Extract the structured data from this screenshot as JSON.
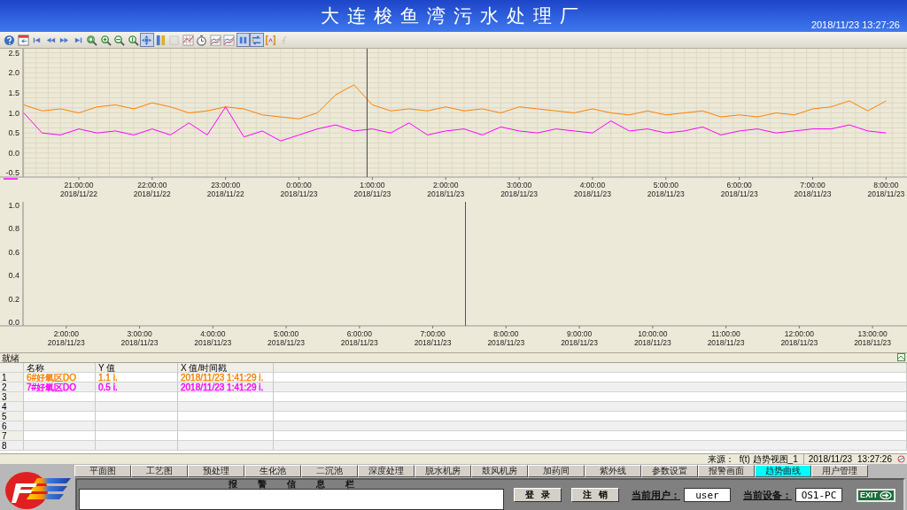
{
  "window": {
    "title": "大连梭鱼湾污水处理厂",
    "datetime": "2018/11/23 13:27:26"
  },
  "toolbar": [
    {
      "kind": "help",
      "pressed": false,
      "disabled": false
    },
    {
      "kind": "calendar",
      "pressed": false,
      "disabled": false
    },
    {
      "kind": "skip-start",
      "pressed": false,
      "disabled": false
    },
    {
      "kind": "rewind",
      "pressed": false,
      "disabled": false
    },
    {
      "kind": "fast-forward",
      "pressed": false,
      "disabled": false
    },
    {
      "kind": "skip-end",
      "pressed": false,
      "disabled": false
    },
    {
      "kind": "zoom-fit",
      "pressed": false,
      "disabled": false
    },
    {
      "kind": "zoom-in",
      "pressed": false,
      "disabled": false
    },
    {
      "kind": "zoom-horizontal",
      "pressed": false,
      "disabled": false
    },
    {
      "kind": "zoom-vertical",
      "pressed": false,
      "disabled": false
    },
    {
      "kind": "pan",
      "pressed": true,
      "disabled": false
    },
    {
      "kind": "ruler",
      "pressed": false,
      "disabled": false
    },
    {
      "kind": "blank",
      "pressed": false,
      "disabled": true
    },
    {
      "kind": "grid",
      "pressed": false,
      "disabled": false
    },
    {
      "kind": "timer",
      "pressed": false,
      "disabled": false
    },
    {
      "kind": "chart",
      "pressed": false,
      "disabled": false
    },
    {
      "kind": "chart",
      "pressed": false,
      "disabled": false
    },
    {
      "kind": "pause",
      "pressed": true,
      "disabled": false
    },
    {
      "kind": "swap",
      "pressed": true,
      "disabled": false
    },
    {
      "kind": "bracket",
      "pressed": false,
      "disabled": false
    },
    {
      "kind": "function",
      "pressed": false,
      "disabled": true
    }
  ],
  "trend_top": {
    "chart_data": {
      "type": "line",
      "grid": true,
      "ylim": [
        -0.6,
        2.6
      ],
      "yticks": [
        {
          "value": -0.5,
          "label": "-0.5"
        },
        {
          "value": 0,
          "label": "0.0"
        },
        {
          "value": 0.5,
          "label": "0.5"
        },
        {
          "value": 1,
          "label": "1.0"
        },
        {
          "value": 1.5,
          "label": "1.5"
        },
        {
          "value": 2,
          "label": "2.0"
        },
        {
          "value": 2.5,
          "label": "2.5"
        }
      ],
      "categories": [
        null,
        null,
        null,
        "21:00:00\n2018/11/22",
        null,
        null,
        null,
        "22:00:00\n2018/11/22",
        null,
        null,
        null,
        "23:00:00\n2018/11/22",
        null,
        null,
        null,
        "0:00:00\n2018/11/23",
        null,
        null,
        null,
        "1:00:00\n2018/11/23",
        null,
        null,
        null,
        "2:00:00\n2018/11/23",
        null,
        null,
        null,
        "3:00:00\n2018/11/23",
        null,
        null,
        null,
        "4:00:00\n2018/11/23",
        null,
        null,
        null,
        "5:00:00\n2018/11/23",
        null,
        null,
        null,
        "6:00:00\n2018/11/23",
        null,
        null,
        null,
        "7:00:00\n2018/11/23",
        null,
        null,
        null,
        "8:00:00\n2018/11/23"
      ],
      "series": [
        {
          "color": "#ff8000",
          "values": [
            1.2,
            1.05,
            1.1,
            1.0,
            1.15,
            1.2,
            1.1,
            1.25,
            1.15,
            1.0,
            1.05,
            1.15,
            1.1,
            0.95,
            0.9,
            0.85,
            1.0,
            1.45,
            1.7,
            1.2,
            1.05,
            1.1,
            1.05,
            1.15,
            1.05,
            1.1,
            1.0,
            1.15,
            1.1,
            1.05,
            1.0,
            1.1,
            1.0,
            0.95,
            1.05,
            0.95,
            1.0,
            1.05,
            0.9,
            0.95,
            0.9,
            1.0,
            0.95,
            1.1,
            1.15,
            1.3,
            1.05,
            1.3
          ]
        },
        {
          "color": "#ff00ff",
          "values": [
            1.0,
            0.5,
            0.45,
            0.6,
            0.5,
            0.55,
            0.45,
            0.6,
            0.45,
            0.75,
            0.45,
            1.15,
            0.4,
            0.55,
            0.3,
            0.45,
            0.6,
            0.7,
            0.55,
            0.6,
            0.5,
            0.75,
            0.45,
            0.55,
            0.6,
            0.45,
            0.65,
            0.55,
            0.5,
            0.6,
            0.55,
            0.5,
            0.8,
            0.55,
            0.6,
            0.5,
            0.55,
            0.65,
            0.45,
            0.55,
            0.6,
            0.5,
            0.55,
            0.6,
            0.6,
            0.7,
            0.55,
            0.5
          ]
        }
      ]
    }
  },
  "trend_bottom": {
    "chart_data": {
      "type": "line",
      "grid": false,
      "ylim": [
        -0.03,
        1.03
      ],
      "yticks": [
        {
          "value": 0,
          "label": "0.0"
        },
        {
          "value": 0.2,
          "label": "0.2"
        },
        {
          "value": 0.4,
          "label": "0.4"
        },
        {
          "value": 0.6,
          "label": "0.6"
        },
        {
          "value": 0.8,
          "label": "0.8"
        },
        {
          "value": 1,
          "label": "1.0"
        }
      ],
      "categories": [
        "2:00:00\n2018/11/23",
        "3:00:00\n2018/11/23",
        "4:00:00\n2018/11/23",
        "5:00:00\n2018/11/23",
        "6:00:00\n2018/11/23",
        "7:00:00\n2018/11/23",
        "8:00:00\n2018/11/23",
        "9:00:00\n2018/11/23",
        "10:00:00\n2018/11/23",
        "11:00:00\n2018/11/23",
        "12:00:00\n2018/11/23",
        "13:00:00\n2018/11/23"
      ]
    }
  },
  "status": "就绪",
  "table": {
    "columns": [
      "名称",
      "Y 值",
      "X 值/时间戳"
    ],
    "rows": [
      {
        "index": "1",
        "name": "6#好氧区DO",
        "y": "1.1 i.",
        "x": "2018/11/23 1:41:29 i.",
        "color": "#ff8000"
      },
      {
        "index": "2",
        "name": "7#好氧区DO",
        "y": "0.5 i.",
        "x": "2018/11/23 1:41:29 i.",
        "color": "#ff00ff"
      },
      {
        "index": "3"
      },
      {
        "index": "4"
      },
      {
        "index": "5"
      },
      {
        "index": "6"
      },
      {
        "index": "7"
      },
      {
        "index": "8"
      }
    ]
  },
  "status_bar": {
    "source_label": "来源：",
    "source": "f(t) 趋势视图_1",
    "date": "2018/11/23",
    "time": "13:27:26"
  },
  "nav": [
    {
      "label": "平面图",
      "selected": false
    },
    {
      "label": "工艺图",
      "selected": false
    },
    {
      "label": "预处理",
      "selected": false
    },
    {
      "label": "生化池",
      "selected": false
    },
    {
      "label": "二沉池",
      "selected": false
    },
    {
      "label": "深度处理",
      "selected": false
    },
    {
      "label": "脱水机房",
      "selected": false
    },
    {
      "label": "鼓风机房",
      "selected": false
    },
    {
      "label": "加药间",
      "selected": false
    },
    {
      "label": "紫外线",
      "selected": false
    },
    {
      "label": "参数设置",
      "selected": false
    },
    {
      "label": "报警画面",
      "selected": false
    },
    {
      "label": "趋势曲线",
      "selected": true
    },
    {
      "label": "用户管理",
      "selected": false
    }
  ],
  "alarm_bar": {
    "title": "报 警 信 息 栏"
  },
  "buttons": [
    "登 录",
    "注 销"
  ],
  "user": {
    "label": "当前用户：",
    "value": "user"
  },
  "device": {
    "label": "当前设备：",
    "value": "OS1-PC"
  },
  "exit": "EXIT"
}
